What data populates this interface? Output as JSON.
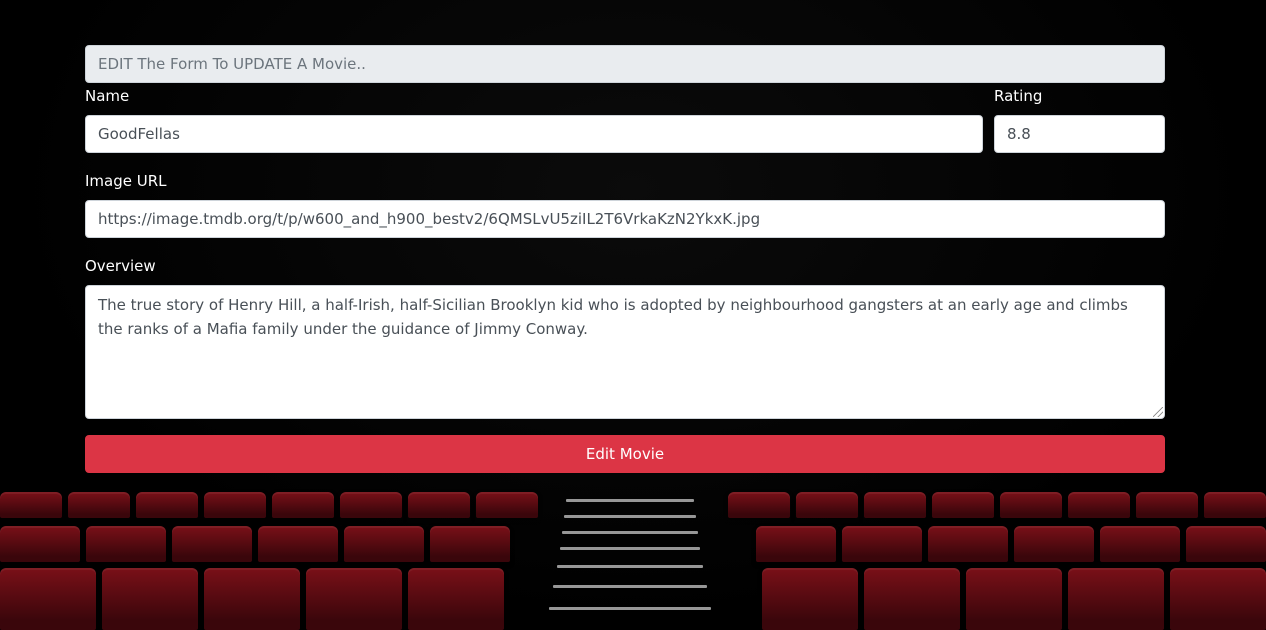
{
  "form": {
    "header_placeholder": "EDIT The Form To UPDATE A Movie..",
    "name_label": "Name",
    "name_value": "GoodFellas",
    "rating_label": "Rating",
    "rating_value": "8.8",
    "image_url_label": "Image URL",
    "image_url_value": "https://image.tmdb.org/t/p/w600_and_h900_bestv2/6QMSLvU5ziIL2T6VrkaKzN2YkxK.jpg",
    "overview_label": "Overview",
    "overview_value": "The true story of Henry Hill, a half-Irish, half-Sicilian Brooklyn kid who is adopted by neighbourhood gangsters at an early age and climbs the ranks of a Mafia family under the guidance of Jimmy Conway.",
    "submit_label": "Edit Movie"
  },
  "colors": {
    "accent": "#dc3545",
    "background": "#000000",
    "seat": "#7a1018"
  }
}
